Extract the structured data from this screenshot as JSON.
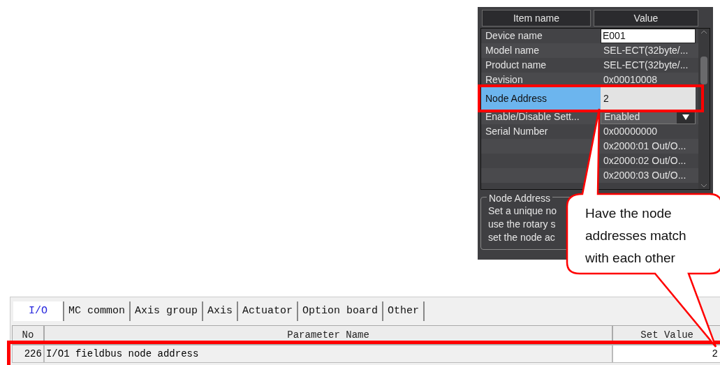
{
  "property_panel": {
    "columns": [
      "Item name",
      "Value"
    ],
    "rows": [
      {
        "name": "Device name",
        "value": "E001",
        "kind": "input",
        "selected": false
      },
      {
        "name": "Model name",
        "value": "SEL-ECT(32byte/...",
        "kind": "text",
        "selected": false
      },
      {
        "name": "Product name",
        "value": "SEL-ECT(32byte/...",
        "kind": "text",
        "selected": false
      },
      {
        "name": "Revision",
        "value": "0x00010008",
        "kind": "text",
        "selected": false
      },
      {
        "name": "Node Address",
        "value": "2",
        "kind": "text",
        "selected": true
      },
      {
        "name": "Enable/Disable Sett...",
        "value": "Enabled",
        "kind": "dropdown",
        "selected": false
      },
      {
        "name": "Serial Number",
        "value": "0x00000000",
        "kind": "text",
        "selected": false
      },
      {
        "name": "",
        "value": "0x2000:01 Out/O...",
        "kind": "text",
        "selected": false
      },
      {
        "name": "",
        "value": "0x2000:02 Out/O...",
        "kind": "text",
        "selected": false
      },
      {
        "name": "",
        "value": "0x2000:03 Out/O...",
        "kind": "text",
        "selected": false
      }
    ],
    "description": {
      "title": "Node Address",
      "lines": [
        "Set a unique no",
        "use the rotary s",
        "set the node ac"
      ]
    }
  },
  "callout": {
    "text": "Have the node addresses match with each other"
  },
  "parameter_table": {
    "tabs": [
      {
        "label": "I/O",
        "selected": true
      },
      {
        "label": "MC common",
        "selected": false
      },
      {
        "label": "Axis group",
        "selected": false
      },
      {
        "label": "Axis",
        "selected": false
      },
      {
        "label": "Actuator",
        "selected": false
      },
      {
        "label": "Option board",
        "selected": false
      },
      {
        "label": "Other",
        "selected": false
      }
    ],
    "columns": [
      "No",
      "Parameter Name",
      "Set Value"
    ],
    "rows": [
      {
        "no": "226",
        "name": "I/O1 fieldbus node address",
        "value": "2",
        "selected": true
      }
    ]
  }
}
